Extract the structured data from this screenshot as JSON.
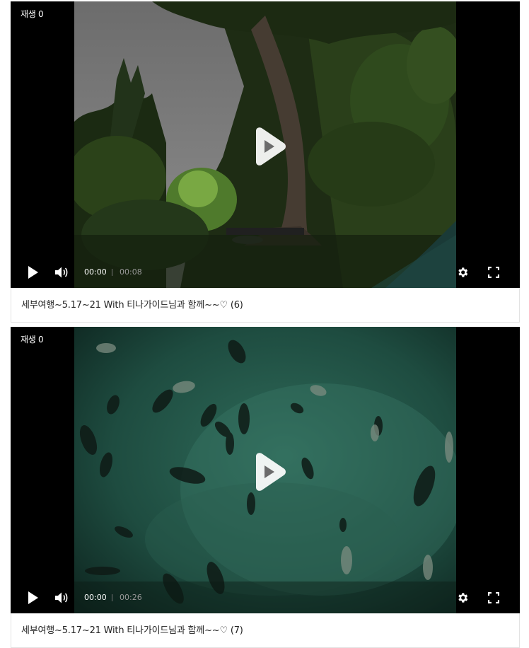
{
  "videos": [
    {
      "play_count": "재생 0",
      "current_time": "00:00",
      "duration": "00:08",
      "title": "세부여행~5.17~21 With 티나가이드님과 함께~~♡ (6)"
    },
    {
      "play_count": "재생 0",
      "current_time": "00:00",
      "duration": "00:26",
      "title": "세부여행~5.17~21 With 티나가이드님과 함께~~♡ (7)"
    }
  ],
  "icons": {
    "play": "play-icon",
    "volume": "volume-icon",
    "settings": "gear-icon",
    "fullscreen": "fullscreen-icon"
  },
  "colors": {
    "player_bg": "#000000",
    "control_text": "#ffffff",
    "duration_text": "#9a9a9a",
    "caption_border": "#e3e3e3"
  }
}
